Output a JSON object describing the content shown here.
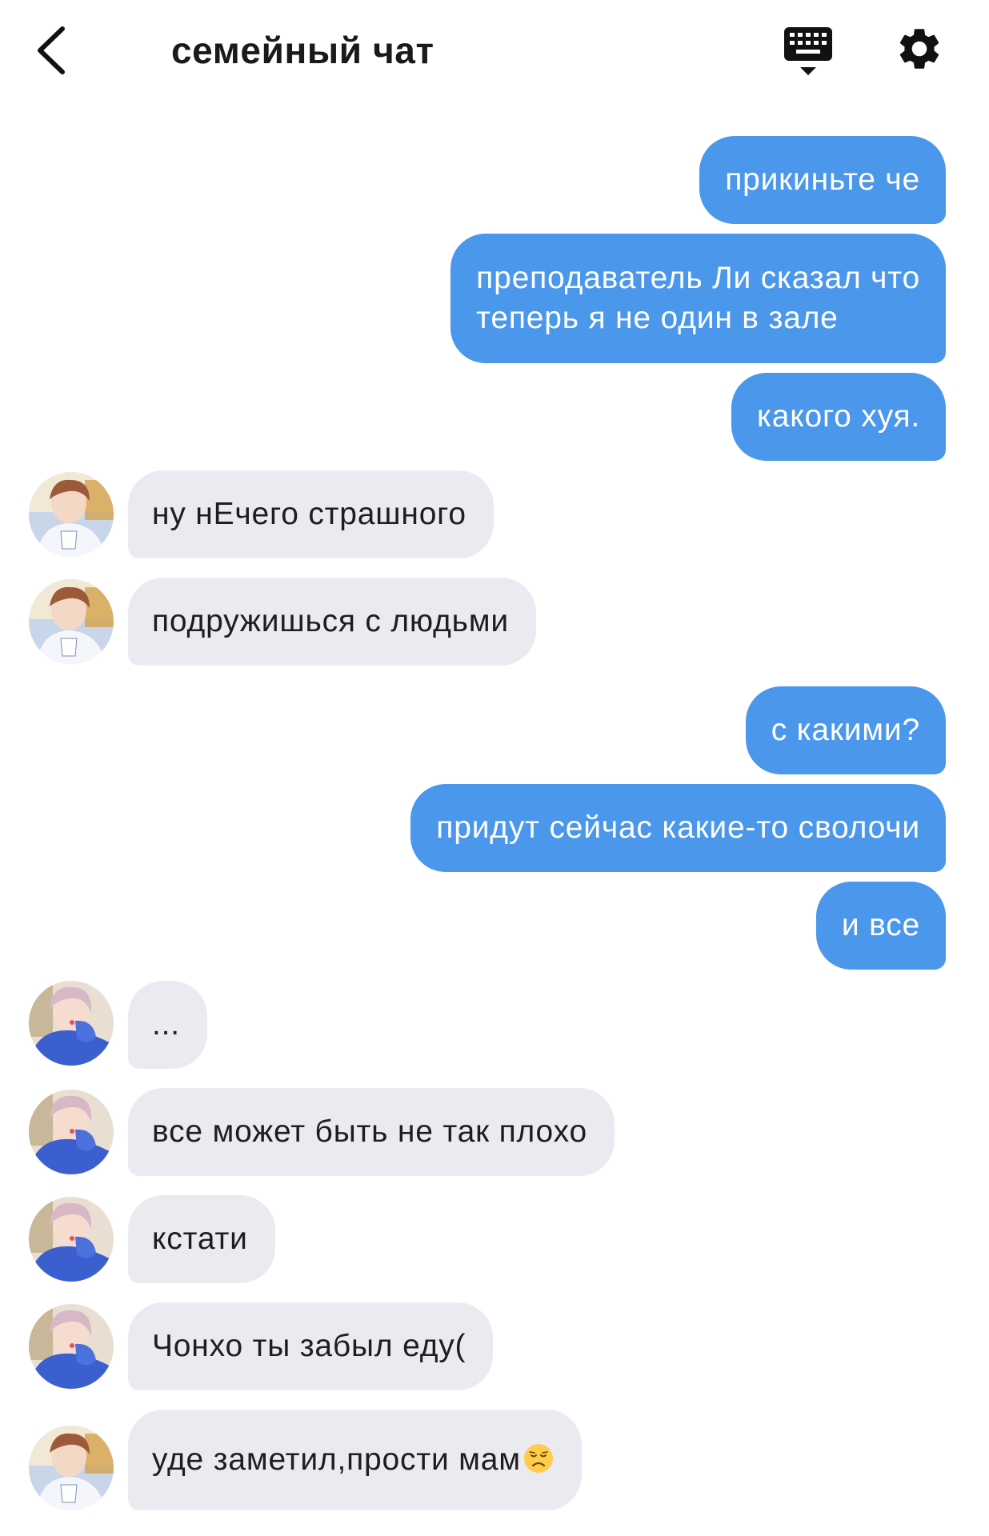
{
  "header": {
    "title": "семейный чат",
    "back_icon": "chevron-left-icon",
    "keyboard_icon": "keyboard-icon",
    "settings_icon": "gear-icon"
  },
  "colors": {
    "outgoing_bubble": "#4a97eb",
    "incoming_bubble": "#e9ebf0"
  },
  "messages": [
    {
      "direction": "outgoing",
      "text": "прикиньте че"
    },
    {
      "direction": "outgoing",
      "text": "преподаватель Ли сказал что\nтеперь я не один в зале"
    },
    {
      "direction": "outgoing",
      "text": "какого хуя."
    },
    {
      "direction": "incoming",
      "avatar": "avatar-user-a",
      "text": "ну нЕчего страшного"
    },
    {
      "direction": "incoming",
      "avatar": "avatar-user-a",
      "text": "подружишься с людьми"
    },
    {
      "direction": "outgoing",
      "text": "с какими?"
    },
    {
      "direction": "outgoing",
      "text": "придут сейчас какие-то сволочи"
    },
    {
      "direction": "outgoing",
      "text": "и все"
    },
    {
      "direction": "incoming",
      "avatar": "avatar-user-b",
      "text": "..."
    },
    {
      "direction": "incoming",
      "avatar": "avatar-user-b",
      "text": "все может быть не так плохо"
    },
    {
      "direction": "incoming",
      "avatar": "avatar-user-b",
      "text": "кстати"
    },
    {
      "direction": "incoming",
      "avatar": "avatar-user-b",
      "text": "Чонхо ты забыл еду("
    },
    {
      "direction": "incoming",
      "avatar": "avatar-user-a",
      "text": "уде заметил,прости мам",
      "emoji": "disappointed-face-emoji"
    }
  ]
}
